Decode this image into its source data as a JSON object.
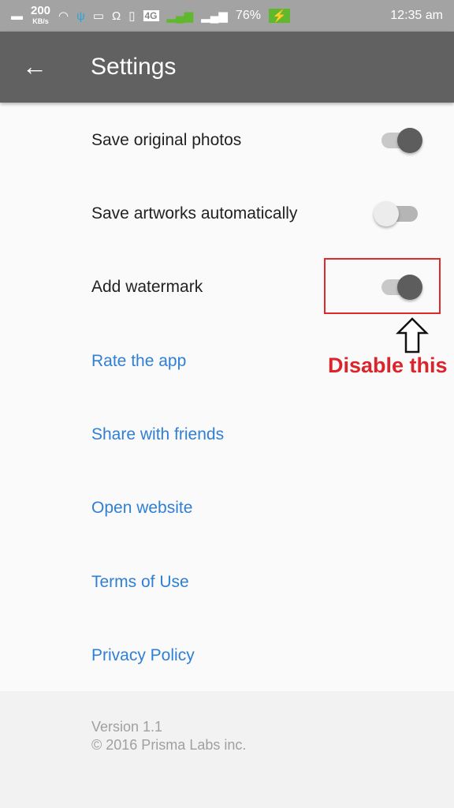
{
  "status_bar": {
    "speed": "200",
    "speed_unit": "KB/s",
    "network": "4G",
    "sim1": "1",
    "sim2": "2",
    "battery": "76%",
    "time": "12:35 am"
  },
  "toolbar": {
    "back_icon": "arrow-left",
    "title": "Settings"
  },
  "settings": [
    {
      "label": "Save original photos",
      "enabled": true
    },
    {
      "label": "Save artworks automatically",
      "enabled": false
    },
    {
      "label": "Add watermark",
      "enabled": true
    }
  ],
  "links": [
    "Rate the app",
    "Share with friends",
    "Open website",
    "Terms of Use",
    "Privacy Policy"
  ],
  "annotation": {
    "text": "Disable this",
    "color": "#d9252b"
  },
  "footer": {
    "version": "Version 1.1",
    "copyright": "© 2016 Prisma Labs inc."
  },
  "colors": {
    "toolbar": "#616161",
    "link": "#2f7fd4",
    "status_bar": "#a3a3a3"
  }
}
